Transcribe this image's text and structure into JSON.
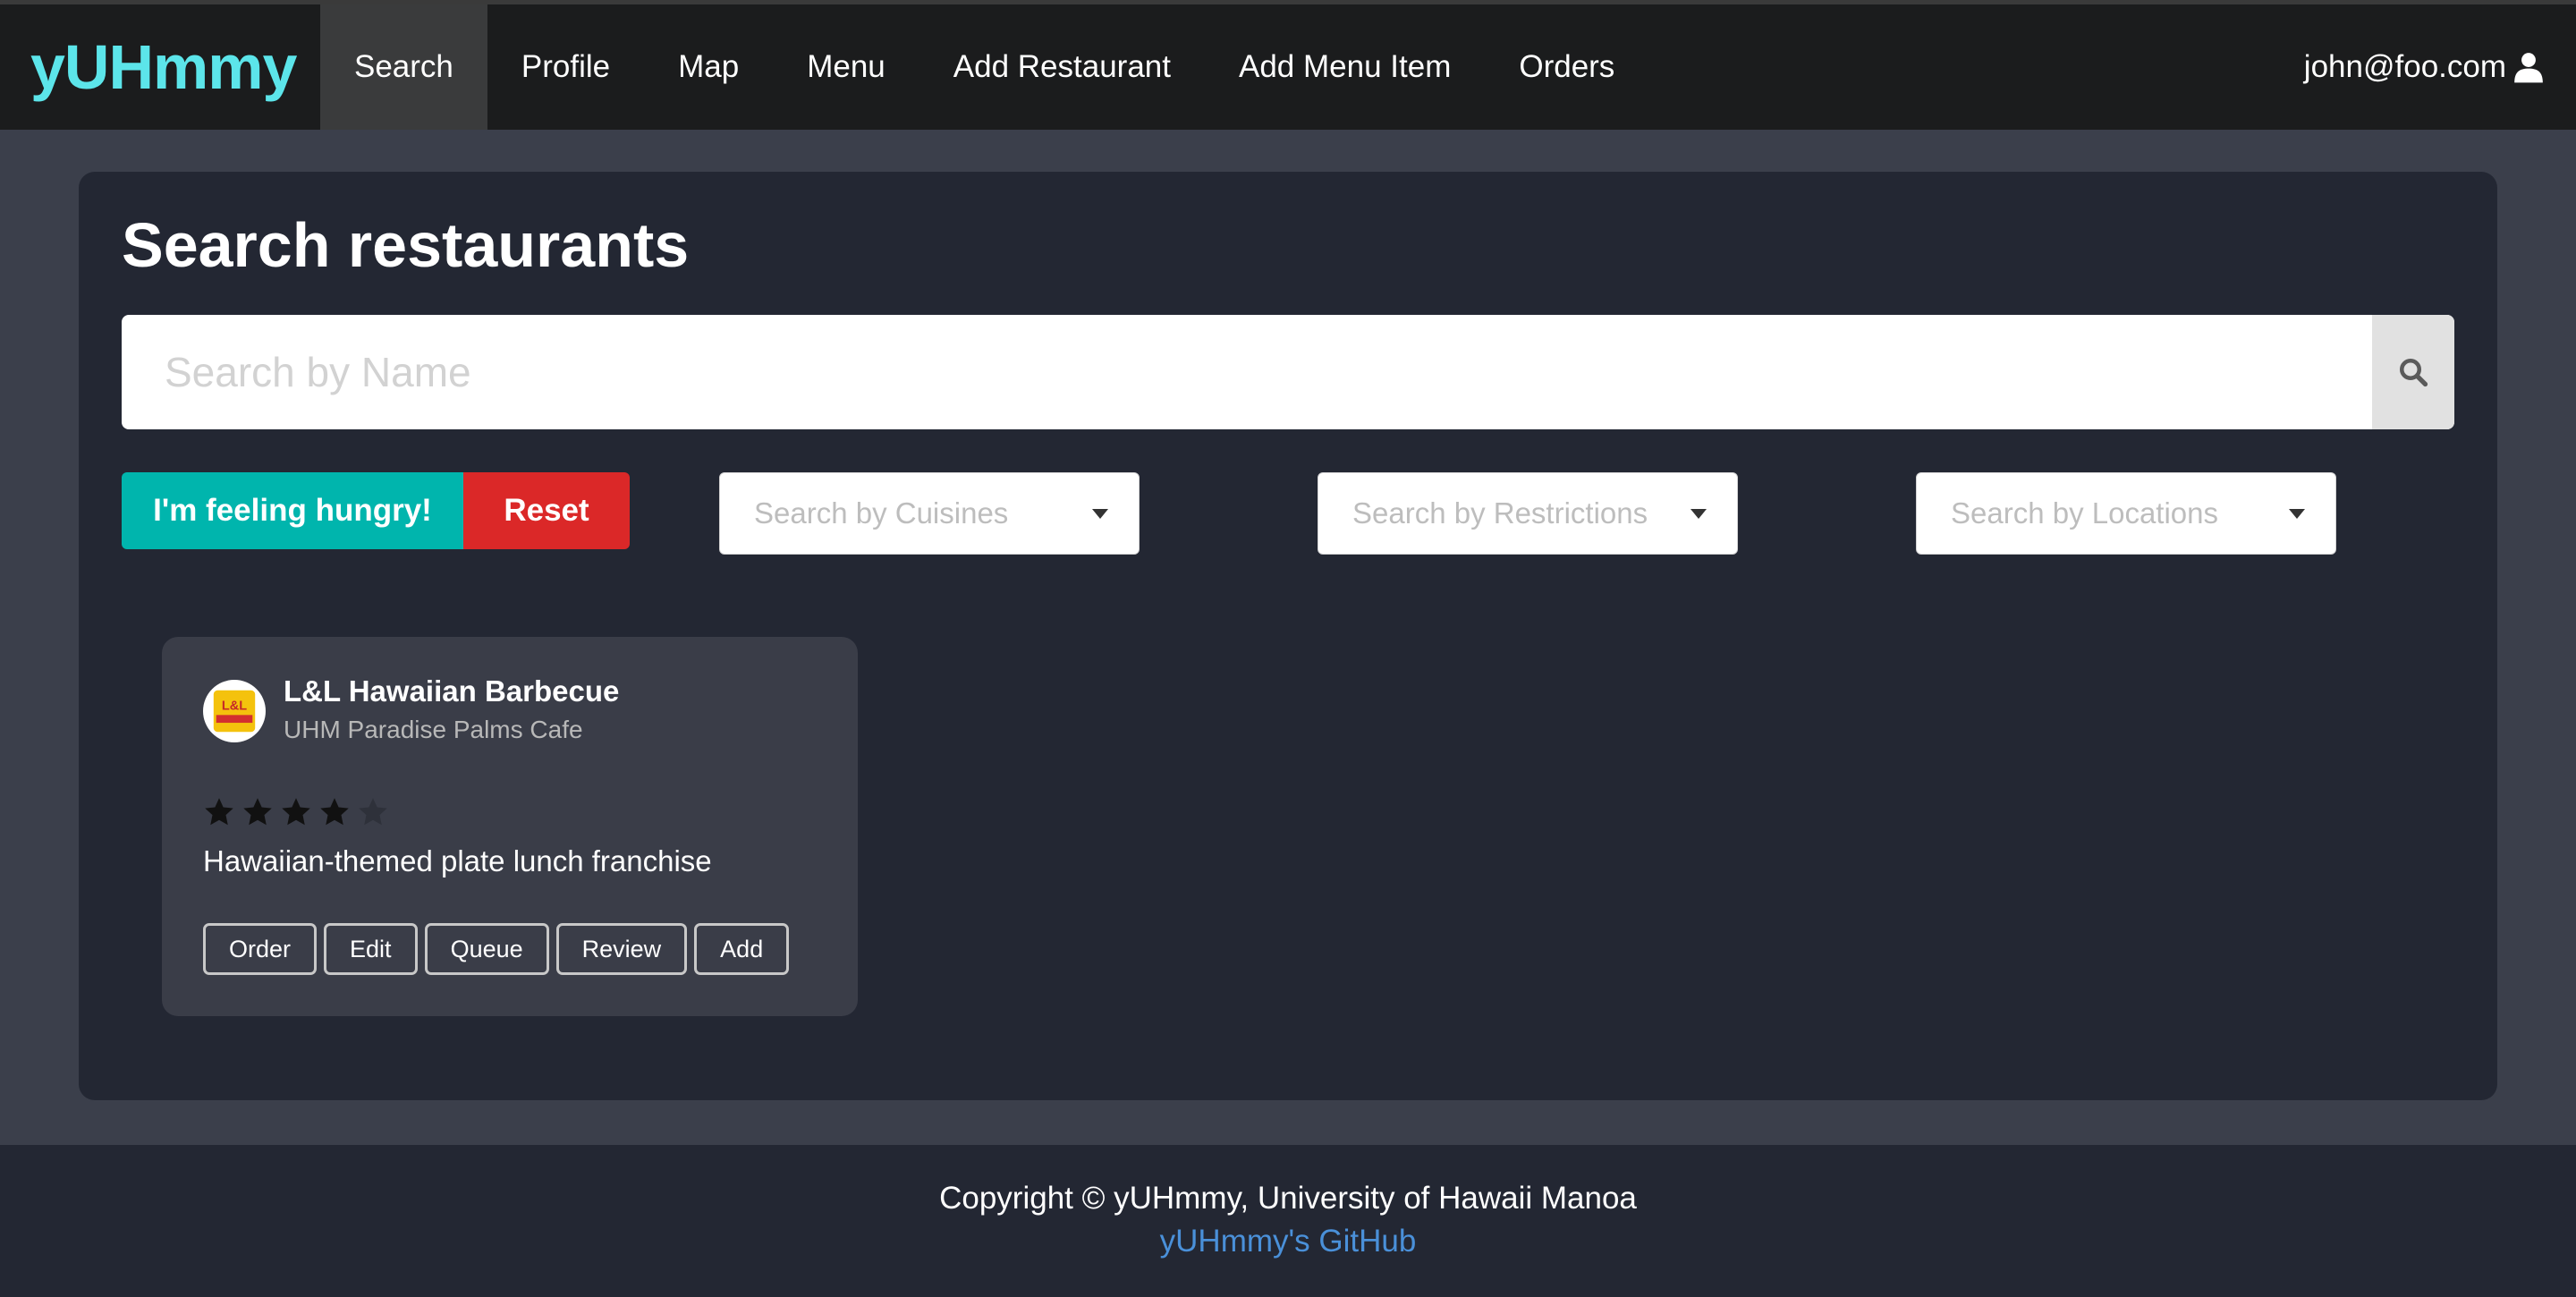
{
  "navbar": {
    "brand": "yUHmmy",
    "items": [
      {
        "label": "Search",
        "active": true
      },
      {
        "label": "Profile"
      },
      {
        "label": "Map"
      },
      {
        "label": "Menu"
      },
      {
        "label": "Add Restaurant"
      },
      {
        "label": "Add Menu Item"
      },
      {
        "label": "Orders"
      }
    ],
    "user": "john@foo.com",
    "user_icon": "user-icon"
  },
  "main": {
    "title": "Search restaurants",
    "search": {
      "placeholder": "Search by Name",
      "icon": "search-icon"
    },
    "buttons": {
      "hungry": "I'm feeling hungry!",
      "reset": "Reset"
    },
    "filters": {
      "cuisines": "Search by Cuisines",
      "restrictions": "Search by Restrictions",
      "locations": "Search by Locations"
    }
  },
  "restaurants": [
    {
      "name": "L&L Hawaiian Barbecue",
      "location": "UHM Paradise Palms Cafe",
      "rating": 4,
      "rating_max": 5,
      "description": "Hawaiian-themed plate lunch franchise",
      "actions": [
        "Order",
        "Edit",
        "Queue",
        "Review",
        "Add"
      ]
    }
  ],
  "footer": {
    "copyright": "Copyright © yUHmmy, University of Hawaii Manoa",
    "github_link": "yUHmmy's GitHub"
  },
  "colors": {
    "brand": "#5ce5ea",
    "hungry": "#00b5ad",
    "reset": "#db2828",
    "link": "#4a90d9"
  }
}
